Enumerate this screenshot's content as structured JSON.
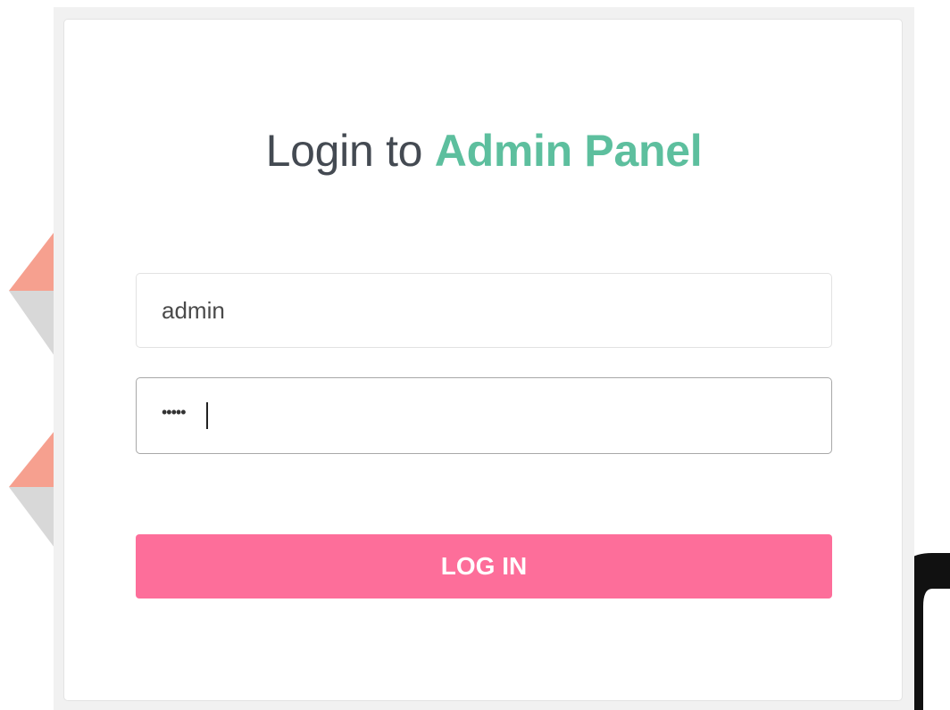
{
  "login": {
    "title_prefix": "Login to",
    "title_accent": "Admin Panel",
    "username_value": "admin",
    "password_masked": "•••••",
    "submit_label": "LOG IN"
  },
  "colors": {
    "accent": "#5dbf9e",
    "button": "#fd6e9a",
    "title_text": "#444a52"
  }
}
